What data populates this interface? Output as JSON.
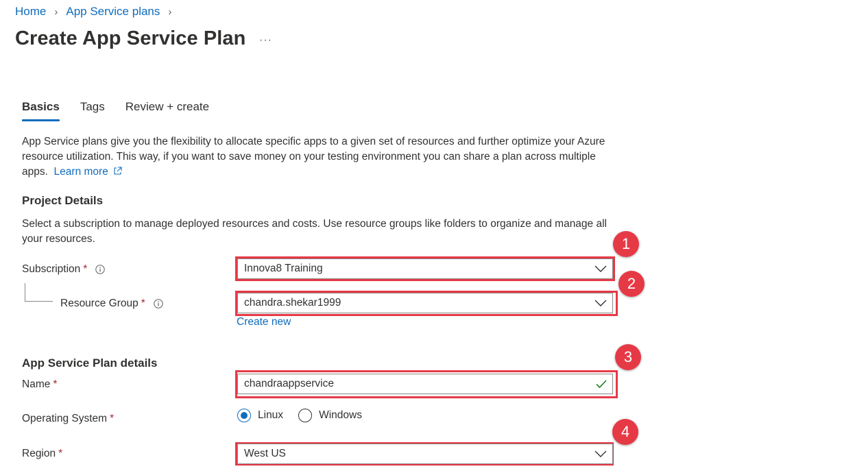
{
  "breadcrumb": {
    "items": [
      "Home",
      "App Service plans"
    ]
  },
  "page": {
    "title": "Create App Service Plan",
    "more": "···"
  },
  "tabs": [
    {
      "label": "Basics",
      "active": true
    },
    {
      "label": "Tags",
      "active": false
    },
    {
      "label": "Review + create",
      "active": false
    }
  ],
  "intro": {
    "text": "App Service plans give you the flexibility to allocate specific apps to a given set of resources and further optimize your Azure resource utilization. This way, if you want to save money on your testing environment you can share a plan across multiple apps.",
    "learn_more": "Learn more"
  },
  "project_details": {
    "title": "Project Details",
    "description": "Select a subscription to manage deployed resources and costs. Use resource groups like folders to organize and manage all your resources.",
    "subscription": {
      "label": "Subscription",
      "value": "Innova8 Training"
    },
    "resource_group": {
      "label": "Resource Group",
      "value": "chandra.shekar1999",
      "create_new": "Create new"
    }
  },
  "plan_details": {
    "title": "App Service Plan details",
    "name": {
      "label": "Name",
      "value": "chandraappservice"
    },
    "os": {
      "label": "Operating System",
      "options": [
        "Linux",
        "Windows"
      ],
      "selected": "Linux"
    },
    "region": {
      "label": "Region",
      "value": "West US"
    }
  },
  "required_mark": "*",
  "annotations": [
    "1",
    "2",
    "3",
    "4"
  ],
  "colors": {
    "accent": "#0f6cbd",
    "highlight": "#e63946",
    "required": "#a4262c",
    "valid": "#107c10"
  }
}
